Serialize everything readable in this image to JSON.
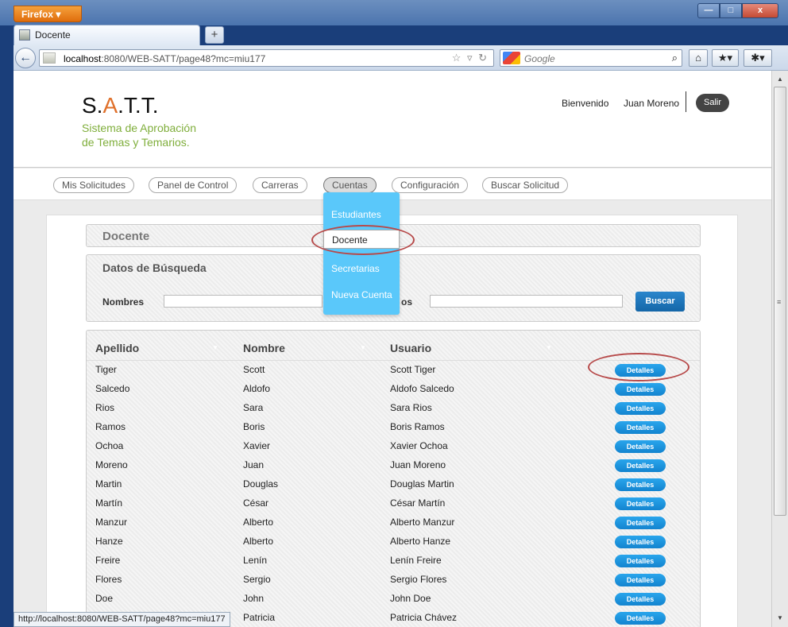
{
  "browser": {
    "firefox_menu": "Firefox",
    "tab_title": "Docente",
    "new_tab": "+",
    "url_host": "localhost",
    "url_rest": ":8080/WEB-SATT/page48?mc=miu177",
    "search_engine": "Google",
    "status_url": "http://localhost:8080/WEB-SATT/page48?mc=miu177",
    "window_buttons": {
      "minimize": "—",
      "maximize": "□",
      "close": "x"
    }
  },
  "header": {
    "logo_parts": [
      "S.",
      "A",
      ".T.T."
    ],
    "subtitle_line1": "Sistema de Aprobación",
    "subtitle_line2": "de Temas y Temarios.",
    "welcome": "Bienvenido",
    "user": "Juan Moreno",
    "logout": "Salir"
  },
  "menu": {
    "items": [
      "Mis Solicitudes",
      "Panel de Control",
      "Carreras",
      "Cuentas",
      "Configuración",
      "Buscar Solicitud"
    ],
    "active": "Cuentas",
    "dropdown": [
      "Estudiantes",
      "Docente",
      "Secretarias",
      "Nueva Cuenta"
    ],
    "dropdown_selected": "Docente"
  },
  "page": {
    "title": "Docente",
    "search_section": "Datos de Búsqueda",
    "search_label_nombres": "Nombres",
    "search_label_apellidos_partial": "os",
    "search_button": "Buscar"
  },
  "table": {
    "columns": [
      "Apellido",
      "Nombre",
      "Usuario"
    ],
    "action_label": "Detalles",
    "rows": [
      [
        "Tiger",
        "Scott",
        "Scott Tiger"
      ],
      [
        "Salcedo",
        "Aldofo",
        "Aldofo Salcedo"
      ],
      [
        "Rios",
        "Sara",
        "Sara Rios"
      ],
      [
        "Ramos",
        "Boris",
        "Boris Ramos"
      ],
      [
        "Ochoa",
        "Xavier",
        "Xavier Ochoa"
      ],
      [
        "Moreno",
        "Juan",
        "Juan Moreno"
      ],
      [
        "Martin",
        "Douglas",
        "Douglas Martin"
      ],
      [
        "Martín",
        "César",
        "César Martín"
      ],
      [
        "Manzur",
        "Alberto",
        "Alberto Manzur"
      ],
      [
        "Hanze",
        "Alberto",
        "Alberto Hanze"
      ],
      [
        "Freire",
        "Lenín",
        "Lenín Freire"
      ],
      [
        "Flores",
        "Sergio",
        "Sergio Flores"
      ],
      [
        "Doe",
        "John",
        "John Doe"
      ],
      [
        "",
        "Patricia",
        "Patricia Chávez"
      ]
    ]
  },
  "colors": {
    "accent_orange": "#e0702a",
    "subtitle_green": "#7fae3b",
    "dropdown_blue": "#5ac8fa",
    "button_blue": "#1a8ad8",
    "annotation_red": "#b74a4a"
  }
}
